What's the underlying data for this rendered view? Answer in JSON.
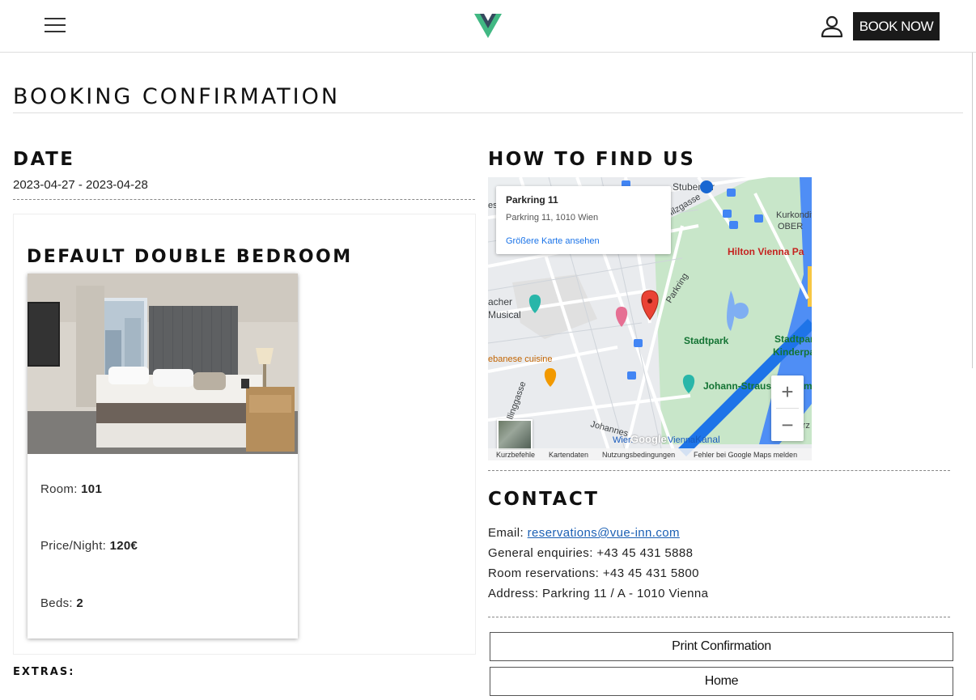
{
  "header": {
    "book_now_label": "BOOK NOW"
  },
  "page": {
    "title": "BOOKING CONFIRMATION"
  },
  "date": {
    "heading": "DATE",
    "value": "2023-04-27 - 2023-04-28"
  },
  "room": {
    "title": "DEFAULT DOUBLE BEDROOM",
    "room_label": "Room: ",
    "room_value": "101",
    "price_label": "Price/Night: ",
    "price_value": "120€",
    "beds_label": "Beds: ",
    "beds_value": "2"
  },
  "extras": {
    "heading": "EXTRAS:"
  },
  "find_us": {
    "heading": "HOW TO FIND US",
    "map": {
      "popup_title": "Parkring 11",
      "popup_address": "Parkring 11, 1010 Wien",
      "popup_link": "Größere Karte ansehen",
      "zoom_in": "+",
      "zoom_out": "−",
      "brand": "Google",
      "footer": [
        "Kurzbefehle",
        "Kartendaten",
        "Nutzungsbedingungen",
        "Fehler bei Google Maps melden"
      ],
      "labels": [
        "Stubentor",
        "Kurkondit",
        "OBER",
        "Hilton Vienna Pa",
        "Parkring",
        "Stadtpark",
        "Stadtpark -",
        "Kinderpark",
        "Johann-Strauss-Denkm",
        "Wien",
        "Vienna",
        "acher",
        "Musical",
        "ebanese cuisine",
        "Tierarz",
        "Johannes",
        "Hilzgasse",
        "llinggasse",
        "Kanal",
        "es"
      ]
    }
  },
  "contact": {
    "heading": "CONTACT",
    "email_label": "Email: ",
    "email_value": "reservations@vue-inn.com",
    "general_label": "General enquiries: ",
    "general_value": "+43 45 431 5888",
    "reservations_label": "Room reservations: ",
    "reservations_value": "+43 45 431 5800",
    "address_label": "Address: ",
    "address_value": "Parkring 11 / A - 1010 Vienna"
  },
  "actions": {
    "print_label": "Print Confirmation",
    "home_label": "Home"
  },
  "colors": {
    "logo_green": "#41b883",
    "logo_dark": "#35495e",
    "map_pin": "#ea4335",
    "link": "#1a5fb4"
  },
  "icons": [
    "menu-icon",
    "vue-logo",
    "user-icon",
    "map-pin-icon",
    "hotel-icon",
    "restaurant-icon",
    "bus-stop-icon",
    "metro-icon"
  ]
}
